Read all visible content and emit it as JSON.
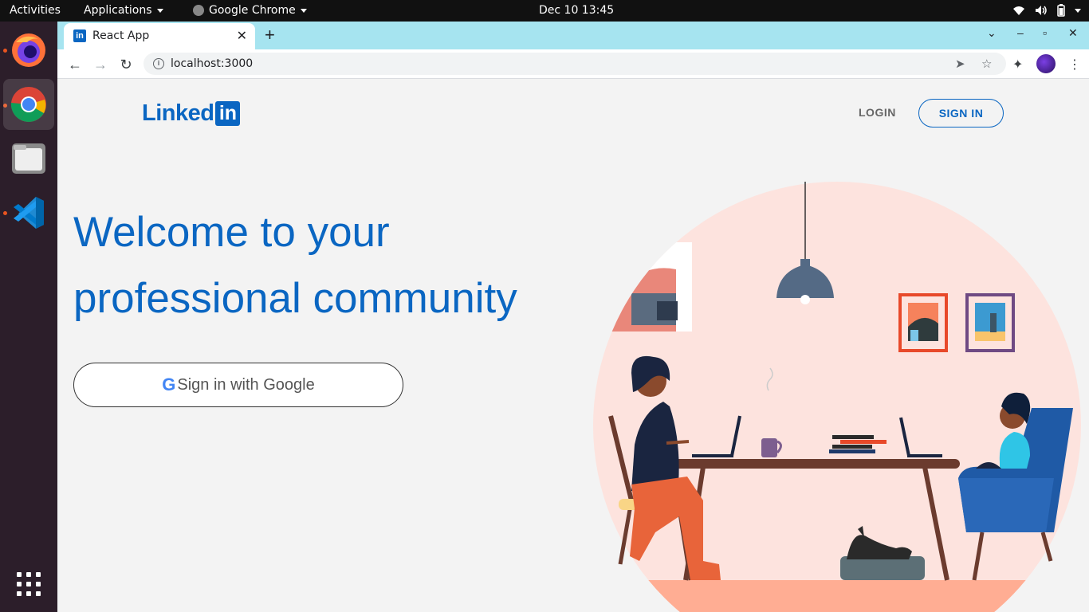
{
  "topbar": {
    "activities": "Activities",
    "applications": "Applications",
    "app_name": "Google Chrome",
    "clock": "Dec 10  13:45"
  },
  "dock": {
    "apps": [
      "firefox-icon",
      "chrome-icon",
      "files-icon",
      "vscode-icon",
      "app-grid-icon"
    ]
  },
  "browser": {
    "tab_title": "React App",
    "url": "localhost:3000"
  },
  "page": {
    "logo_text": "Linked",
    "logo_box": "in",
    "login_label": "LOGIN",
    "signin_label": "SIGN IN",
    "headline_line1": "Welcome to your",
    "headline_line2": "professional community",
    "google_g": "G",
    "google_button_label": "Sign in with Google"
  },
  "colors": {
    "brand": "#0a66c2",
    "tabstrip": "#a6e4f0",
    "page_bg": "#f3f3f3",
    "illustration_circle": "#fde3de"
  }
}
